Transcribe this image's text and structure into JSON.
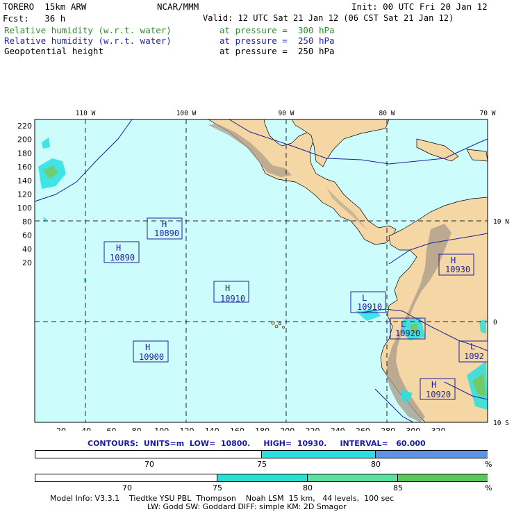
{
  "header": {
    "model": "TORERO  15km ARW",
    "org": "NCAR/MMM",
    "init": "Init: 00 UTC Fri 20 Jan 12",
    "fcst": "Fcst:   36 h",
    "valid": "Valid: 12 UTC Sat 21 Jan 12 (06 CST Sat 21 Jan 12)",
    "fields": [
      {
        "name": "Relative humidity (w.r.t. water)",
        "level": "at pressure =  300 hPa",
        "color": "#2e8b2e"
      },
      {
        "name": "Relative humidity (w.r.t. water)",
        "level": "at pressure =  250 hPa",
        "color": "#1f1fb4"
      },
      {
        "name": "Geopotential height",
        "level": "at pressure =  250 hPa",
        "color": "#000000"
      }
    ]
  },
  "map": {
    "lon_labels": [
      "110 W",
      "100 W",
      "90 W",
      "80 W",
      "70 W"
    ],
    "lat_labels": [
      "10 N",
      "0",
      "10 S"
    ],
    "y_ticks": [
      "220",
      "200",
      "180",
      "160",
      "140",
      "120",
      "100",
      "80",
      "60",
      "40",
      "20"
    ],
    "x_ticks": [
      "20",
      "40",
      "60",
      "80",
      "100",
      "120",
      "140",
      "160",
      "180",
      "200",
      "220",
      "240",
      "260",
      "280",
      "300",
      "320"
    ],
    "highs_lows": [
      {
        "type": "H",
        "value": "10890"
      },
      {
        "type": "H",
        "value": "10890"
      },
      {
        "type": "H",
        "value": "10910"
      },
      {
        "type": "H",
        "value": "10900"
      },
      {
        "type": "L",
        "value": "10910"
      },
      {
        "type": "L",
        "value": "10920"
      },
      {
        "type": "H",
        "value": "10930"
      },
      {
        "type": "L",
        "value": "1092"
      },
      {
        "type": "H",
        "value": "10920"
      }
    ],
    "colors": {
      "ocean": "#ccfcfc",
      "land": "#f5d7a6",
      "terrain": "#a89a8a"
    }
  },
  "contour_info": "CONTOURS:  UNITS=m  LOW=  10800.     HIGH=  10930.     INTERVAL=   60.000",
  "colorbar1": {
    "ticks": [
      "70",
      "75",
      "80"
    ],
    "unit": "%",
    "colors": [
      "#ffffff",
      "#28e0e0",
      "#5a95e8"
    ]
  },
  "colorbar2": {
    "ticks": [
      "70",
      "75",
      "80",
      "85"
    ],
    "unit": "%",
    "colors": [
      "#ffffff",
      "#2be0d0",
      "#5ce0a0",
      "#5cc85c"
    ]
  },
  "footer": {
    "line1": "Model Info: V3.3.1    Tiedtke YSU PBL  Thompson    Noah LSM  15 km,   44 levels,  100 sec",
    "line2": "LW: Godd SW: Goddard DIFF: simple KM: 2D Smagor"
  }
}
